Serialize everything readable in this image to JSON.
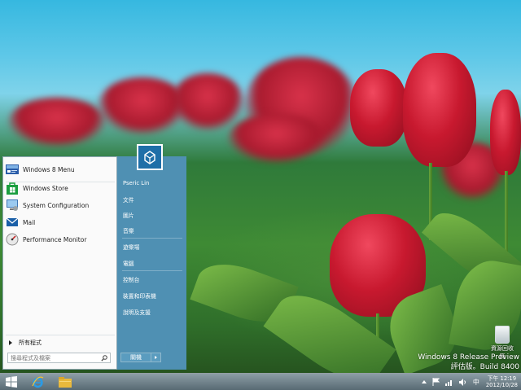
{
  "desktop": {
    "icons": [
      {
        "name": "recycle-bin",
        "label": "資源回收筒"
      }
    ],
    "watermark": {
      "line1": "Windows 8 Release Preview",
      "line2": "評估版。Build 8400"
    }
  },
  "start_menu": {
    "programs": [
      {
        "label": "Windows 8 Menu",
        "icon": "windows8-menu-icon"
      },
      {
        "label": "Windows Store",
        "icon": "store-bag-icon"
      },
      {
        "label": "System Configuration",
        "icon": "system-config-icon"
      },
      {
        "label": "Mail",
        "icon": "mail-icon"
      },
      {
        "label": "Performance Monitor",
        "icon": "performance-monitor-icon"
      }
    ],
    "all_programs": "所有程式",
    "search": {
      "value": "",
      "placeholder": "搜尋程式及檔案"
    },
    "user_name": "Pseric Lin",
    "places": [
      "文件",
      "圖片",
      "音樂",
      "遊樂場",
      "電腦",
      "控制台",
      "裝置和印表機",
      "說明及支援"
    ],
    "shutdown_label": "關機"
  },
  "taskbar": {
    "pinned": [
      "start-button",
      "internet-explorer-icon",
      "file-explorer-icon"
    ],
    "tray": {
      "ime": "中",
      "time": "下午 12:19",
      "date": "2012/10/28"
    }
  },
  "colors": {
    "start_right_pane": "#4f90b3",
    "taskbar": "#5a7380"
  }
}
